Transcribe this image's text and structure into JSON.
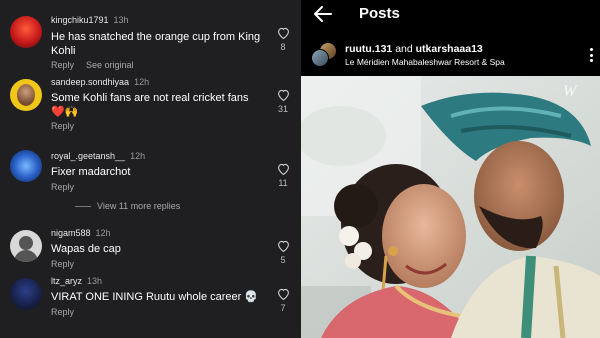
{
  "comments": [
    {
      "username": "kingchiku1791",
      "time": "13h",
      "text": "He has snatched the orange cup from King Kohli",
      "reply": "Reply",
      "extra": "See original",
      "likes": "8"
    },
    {
      "username": "sandeep.sondhiyaa",
      "time": "12h",
      "text": "Some Kohli fans  are not real cricket fans ❤️🙌",
      "reply": "Reply",
      "likes": "31"
    },
    {
      "username": "royal_.geetansh__",
      "time": "12h",
      "text": "Fixer madarchot",
      "reply": "Reply",
      "likes": "11"
    },
    {
      "username": "nigam588",
      "time": "12h",
      "text": "Wapas de cap",
      "reply": "Reply",
      "likes": "5"
    },
    {
      "username": "ltz_aryz",
      "time": "13h",
      "text": "VIRAT ONE INING Ruutu whole career 💀",
      "reply": "Reply",
      "likes": "7"
    }
  ],
  "view_more_replies": "View 11 more replies",
  "post": {
    "title": "Posts",
    "user1": "ruutu.131",
    "connector": "and",
    "user2": "utkarshaaa13",
    "location": "Le Méridien Mahabaleshwar Resort & Spa"
  },
  "icons": {
    "back": "back-arrow-icon",
    "like": "heart-icon",
    "more": "more-vertical-icon"
  }
}
